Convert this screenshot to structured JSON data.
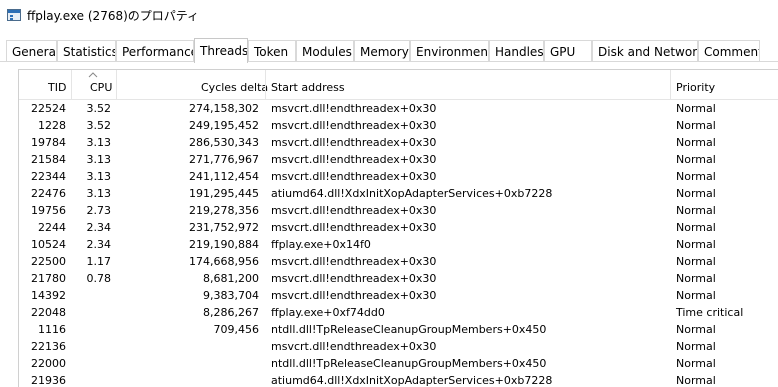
{
  "window": {
    "title": "ffplay.exe (2768)のプロパティ",
    "icon": "window-app-icon"
  },
  "tabs": [
    {
      "label": "General",
      "active": false
    },
    {
      "label": "Statistics",
      "active": false
    },
    {
      "label": "Performance",
      "active": false
    },
    {
      "label": "Threads",
      "active": true
    },
    {
      "label": "Token",
      "active": false
    },
    {
      "label": "Modules",
      "active": false
    },
    {
      "label": "Memory",
      "active": false
    },
    {
      "label": "Environment",
      "active": false
    },
    {
      "label": "Handles",
      "active": false
    },
    {
      "label": "GPU",
      "active": false
    },
    {
      "label": "Disk and Network",
      "active": false
    },
    {
      "label": "Comment",
      "active": false
    }
  ],
  "threads": {
    "columns": {
      "tid": "TID",
      "cpu": "CPU",
      "cycles": "Cycles delta",
      "start": "Start address",
      "priority": "Priority"
    },
    "sort_indicator": "chevron-up",
    "rows": [
      {
        "tid": "22524",
        "cpu": "3.52",
        "cycles": "274,158,302",
        "start": "msvcrt.dll!endthreadex+0x30",
        "priority": "Normal"
      },
      {
        "tid": "1228",
        "cpu": "3.52",
        "cycles": "249,195,452",
        "start": "msvcrt.dll!endthreadex+0x30",
        "priority": "Normal"
      },
      {
        "tid": "19784",
        "cpu": "3.13",
        "cycles": "286,530,343",
        "start": "msvcrt.dll!endthreadex+0x30",
        "priority": "Normal"
      },
      {
        "tid": "21584",
        "cpu": "3.13",
        "cycles": "271,776,967",
        "start": "msvcrt.dll!endthreadex+0x30",
        "priority": "Normal"
      },
      {
        "tid": "22344",
        "cpu": "3.13",
        "cycles": "241,112,454",
        "start": "msvcrt.dll!endthreadex+0x30",
        "priority": "Normal"
      },
      {
        "tid": "22476",
        "cpu": "3.13",
        "cycles": "191,295,445",
        "start": "atiumd64.dll!XdxInitXopAdapterServices+0xb7228",
        "priority": "Normal"
      },
      {
        "tid": "19756",
        "cpu": "2.73",
        "cycles": "219,278,356",
        "start": "msvcrt.dll!endthreadex+0x30",
        "priority": "Normal"
      },
      {
        "tid": "2244",
        "cpu": "2.34",
        "cycles": "231,752,972",
        "start": "msvcrt.dll!endthreadex+0x30",
        "priority": "Normal"
      },
      {
        "tid": "10524",
        "cpu": "2.34",
        "cycles": "219,190,884",
        "start": "ffplay.exe+0x14f0",
        "priority": "Normal"
      },
      {
        "tid": "22500",
        "cpu": "1.17",
        "cycles": "174,668,956",
        "start": "msvcrt.dll!endthreadex+0x30",
        "priority": "Normal"
      },
      {
        "tid": "21780",
        "cpu": "0.78",
        "cycles": "8,681,200",
        "start": "msvcrt.dll!endthreadex+0x30",
        "priority": "Normal"
      },
      {
        "tid": "14392",
        "cpu": "",
        "cycles": "9,383,704",
        "start": "msvcrt.dll!endthreadex+0x30",
        "priority": "Normal"
      },
      {
        "tid": "22048",
        "cpu": "",
        "cycles": "8,286,267",
        "start": "ffplay.exe+0xf74dd0",
        "priority": "Time critical"
      },
      {
        "tid": "1116",
        "cpu": "",
        "cycles": "709,456",
        "start": "ntdll.dll!TpReleaseCleanupGroupMembers+0x450",
        "priority": "Normal"
      },
      {
        "tid": "22136",
        "cpu": "",
        "cycles": "",
        "start": "msvcrt.dll!endthreadex+0x30",
        "priority": "Normal"
      },
      {
        "tid": "22000",
        "cpu": "",
        "cycles": "",
        "start": "ntdll.dll!TpReleaseCleanupGroupMembers+0x450",
        "priority": "Normal"
      },
      {
        "tid": "21936",
        "cpu": "",
        "cycles": "",
        "start": "atiumd64.dll!XdxInitXopAdapterServices+0xb7228",
        "priority": "Normal"
      }
    ]
  }
}
